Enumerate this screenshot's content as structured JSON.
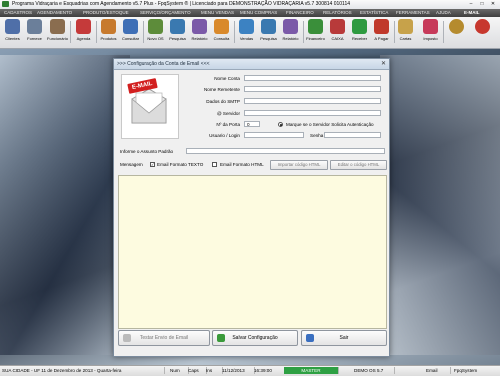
{
  "window": {
    "title": "Programa Vidraçaria e Esquadrias com Agendamento v5.7 Plus - FpqSystem ® | Licenciado para  DEMONSTRAÇÃO VIDRAÇARIA v5.7 300814 010114"
  },
  "menu": [
    "CADASTROS",
    "AGENDAMENTO",
    "PRODUTO/ESTOQUE",
    "SERVIÇO/ORÇAMENTO",
    "MENU VENDAS",
    "MENU COMPRAS",
    "FINANCEIRO",
    "RELATÓRIOS",
    "ESTATÍSTICA",
    "FERRAMENTAS",
    "AJUDA",
    "E-MAIL"
  ],
  "toolbar": [
    {
      "label": "Clientes",
      "icon": "people-icon",
      "color": "#4f6fa8"
    },
    {
      "label": "Fornece",
      "icon": "supplier-icon",
      "color": "#6b7f9a"
    },
    {
      "label": "Funcionário",
      "icon": "employee-icon",
      "color": "#8a6d4f"
    },
    {
      "label": "Agenda",
      "icon": "calendar-icon",
      "color": "#c53a3a"
    },
    {
      "label": "Produtos",
      "icon": "products-icon",
      "color": "#c77a2e"
    },
    {
      "label": "Consultar",
      "icon": "consult-icon",
      "color": "#3f6fb6"
    },
    {
      "label": "Novo OS",
      "icon": "new-os-icon",
      "color": "#5d8c3a"
    },
    {
      "label": "Pesquisa",
      "icon": "search-icon",
      "color": "#3a79b0"
    },
    {
      "label": "Relatório",
      "icon": "report-icon",
      "color": "#7b5aa8"
    },
    {
      "label": "Consulta",
      "icon": "consult-orange-icon",
      "color": "#d9892b"
    },
    {
      "label": "Vendas",
      "icon": "sales-icon",
      "color": "#3c82c2"
    },
    {
      "label": "Pesquisa",
      "icon": "search-icon",
      "color": "#3a79b0"
    },
    {
      "label": "Relatório",
      "icon": "report-icon",
      "color": "#7b5aa8"
    },
    {
      "label": "Financeiro",
      "icon": "finance-icon",
      "color": "#3a8f3a"
    },
    {
      "label": "CAIXA",
      "icon": "cash-register-icon",
      "color": "#b83a3a"
    },
    {
      "label": "Receber",
      "icon": "receive-money-icon",
      "color": "#2e9a40"
    },
    {
      "label": "A Pagar",
      "icon": "pay-money-icon",
      "color": "#c0392b"
    },
    {
      "label": "Cartas",
      "icon": "letters-icon",
      "color": "#c7a24a"
    },
    {
      "label": "Imposto",
      "icon": "tax-icon",
      "color": "#c73a5a"
    },
    {
      "label": "",
      "icon": "gear-icon",
      "color": "#b58b2e"
    },
    {
      "label": "",
      "icon": "exit-icon",
      "color": "#c7382e"
    }
  ],
  "dialog": {
    "title": ">>> Configuração da Conta de Email <<<",
    "logo_text": "E-MAIL",
    "labels": {
      "nome_conta": "Nome Conta",
      "nome_remetente": "Nome Remetente",
      "dados_smtp": "Dados do SMTP",
      "servidor": "@ Servidor",
      "porta": "Nº da Porta",
      "usuario": "Usuario / Login",
      "senha": "Senha",
      "assunto": "Informe o Assunto Padrão",
      "mensagem": "Mensagem"
    },
    "values": {
      "porta": "0",
      "auth": "Marque se o Servidor Solicita Autenticação"
    },
    "options": {
      "formato_texto": "Email Formato TEXTO",
      "formato_html": "Email Formato HTML",
      "importar_html": "Importar código HTML",
      "editar_html": "Editar o código HTML"
    },
    "buttons": {
      "testar": "Testar Envio de Email",
      "salvar": "Salvar Configuração",
      "sair": "Sair"
    }
  },
  "status": {
    "cidade": "SUA CIDADE - UF 11 de Dezembro de 2013 - Quarta-feira",
    "num": "Num",
    "caps": "Caps",
    "ins": "Ins",
    "date": "11/12/2013",
    "time": "16:39:00",
    "master": "MASTER",
    "demo": "DEMO OS 5.7",
    "email": "Email",
    "brand": "FpqSystem"
  }
}
